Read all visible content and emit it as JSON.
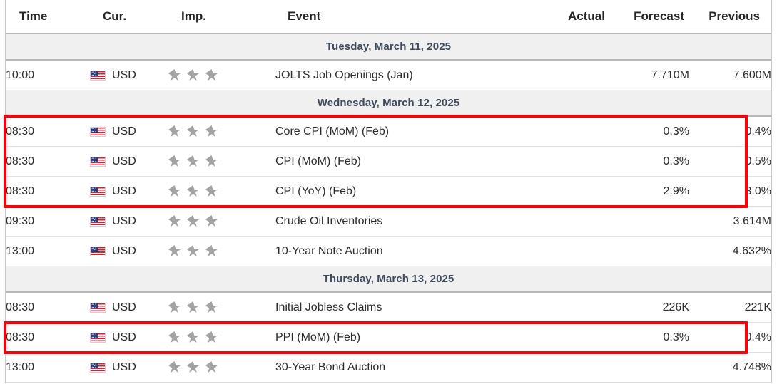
{
  "table": {
    "columns": [
      {
        "key": "time",
        "label": "Time",
        "align": "left"
      },
      {
        "key": "currency",
        "label": "Cur.",
        "align": "left"
      },
      {
        "key": "impact",
        "label": "Imp.",
        "align": "left"
      },
      {
        "key": "event",
        "label": "Event",
        "align": "left"
      },
      {
        "key": "actual",
        "label": "Actual",
        "align": "right"
      },
      {
        "key": "forecast",
        "label": "Forecast",
        "align": "right"
      },
      {
        "key": "previous",
        "label": "Previous",
        "align": "right"
      }
    ],
    "sections": [
      {
        "date_label": "Tuesday, March 11, 2025",
        "rows": [
          {
            "time": "10:00",
            "currency": "USD",
            "flag_icon": "us-flag-icon",
            "importance_stars": 3,
            "event": "JOLTS Job Openings (Jan)",
            "actual": "",
            "forecast": "7.710M",
            "previous": "7.600M",
            "highlighted": false
          }
        ]
      },
      {
        "date_label": "Wednesday, March 12, 2025",
        "rows": [
          {
            "time": "08:30",
            "currency": "USD",
            "flag_icon": "us-flag-icon",
            "importance_stars": 3,
            "event": "Core CPI (MoM) (Feb)",
            "actual": "",
            "forecast": "0.3%",
            "previous": "0.4%",
            "highlighted": true
          },
          {
            "time": "08:30",
            "currency": "USD",
            "flag_icon": "us-flag-icon",
            "importance_stars": 3,
            "event": "CPI (MoM) (Feb)",
            "actual": "",
            "forecast": "0.3%",
            "previous": "0.5%",
            "highlighted": true
          },
          {
            "time": "08:30",
            "currency": "USD",
            "flag_icon": "us-flag-icon",
            "importance_stars": 3,
            "event": "CPI (YoY) (Feb)",
            "actual": "",
            "forecast": "2.9%",
            "previous": "3.0%",
            "highlighted": true
          },
          {
            "time": "09:30",
            "currency": "USD",
            "flag_icon": "us-flag-icon",
            "importance_stars": 3,
            "event": "Crude Oil Inventories",
            "actual": "",
            "forecast": "",
            "previous": "3.614M",
            "highlighted": false
          },
          {
            "time": "13:00",
            "currency": "USD",
            "flag_icon": "us-flag-icon",
            "importance_stars": 3,
            "event": "10-Year Note Auction",
            "actual": "",
            "forecast": "",
            "previous": "4.632%",
            "highlighted": false
          }
        ]
      },
      {
        "date_label": "Thursday, March 13, 2025",
        "rows": [
          {
            "time": "08:30",
            "currency": "USD",
            "flag_icon": "us-flag-icon",
            "importance_stars": 3,
            "event": "Initial Jobless Claims",
            "actual": "",
            "forecast": "226K",
            "previous": "221K",
            "highlighted": false
          },
          {
            "time": "08:30",
            "currency": "USD",
            "flag_icon": "us-flag-icon",
            "importance_stars": 3,
            "event": "PPI (MoM) (Feb)",
            "actual": "",
            "forecast": "0.3%",
            "previous": "0.4%",
            "highlighted": true
          },
          {
            "time": "13:00",
            "currency": "USD",
            "flag_icon": "us-flag-icon",
            "importance_stars": 3,
            "event": "30-Year Bond Auction",
            "actual": "",
            "forecast": "",
            "previous": "4.748%",
            "highlighted": false
          }
        ]
      }
    ]
  },
  "annotations": {
    "highlight_color": "#fb0007",
    "groups": [
      {
        "name": "cpi-highlight-box",
        "first_event": "Core CPI (MoM) (Feb)",
        "last_event": "CPI (YoY) (Feb)"
      },
      {
        "name": "ppi-highlight-box",
        "first_event": "PPI (MoM) (Feb)",
        "last_event": "PPI (MoM) (Feb)"
      }
    ]
  },
  "theme": {
    "header_text": "#232526",
    "date_text": "#3d4a5c",
    "date_band": "#f0f0f0",
    "row_text": "#2c2c2c",
    "star_color": "#a3a3a3",
    "border": "#e2e2e2"
  }
}
